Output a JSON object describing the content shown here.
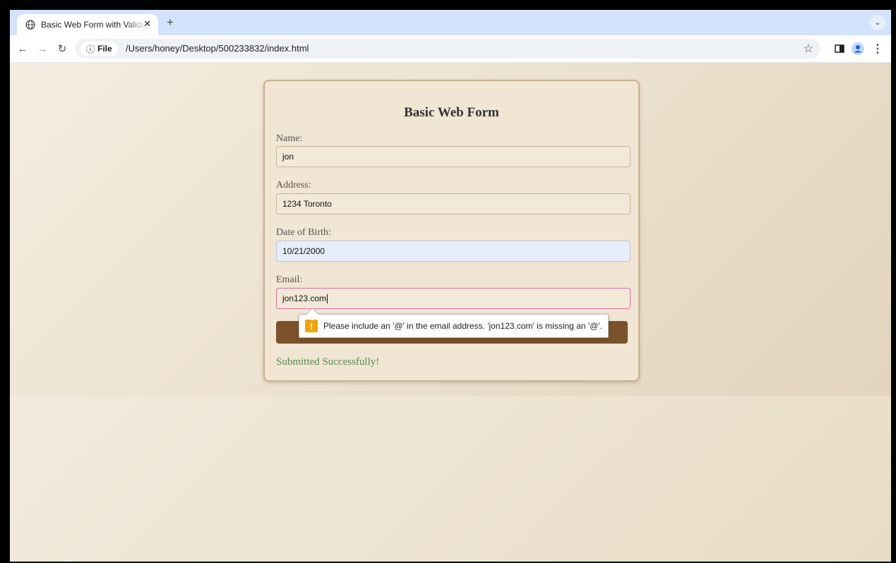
{
  "browser": {
    "tab_title": "Basic Web Form with Validation",
    "tab_close": "✕",
    "new_tab": "+",
    "tab_menu": "⌄",
    "site_chip": "File",
    "url": "/Users/honey/Desktop/500233832/index.html",
    "icons": {
      "back": "←",
      "forward": "→",
      "reload": "↻",
      "info": "ⓘ",
      "star": "☆",
      "menu": "⋮"
    }
  },
  "form": {
    "title": "Basic Web Form",
    "fields": [
      {
        "label": "Name:",
        "value": "jon"
      },
      {
        "label": "Address:",
        "value": "1234 Toronto"
      },
      {
        "label": "Date of Birth:",
        "value": "10/21/2000"
      },
      {
        "label": "Email:",
        "value": "jon123.com"
      }
    ],
    "status_message": "Submitted Successfully!"
  },
  "validation": {
    "icon": "!",
    "message": "Please include an '@' in the email address. 'jon123.com' is missing an '@'."
  },
  "colors": {
    "button": "#7a532b",
    "success": "#4f8c4f",
    "invalid_border": "#e06aa8",
    "warning": "#f0a30a"
  }
}
